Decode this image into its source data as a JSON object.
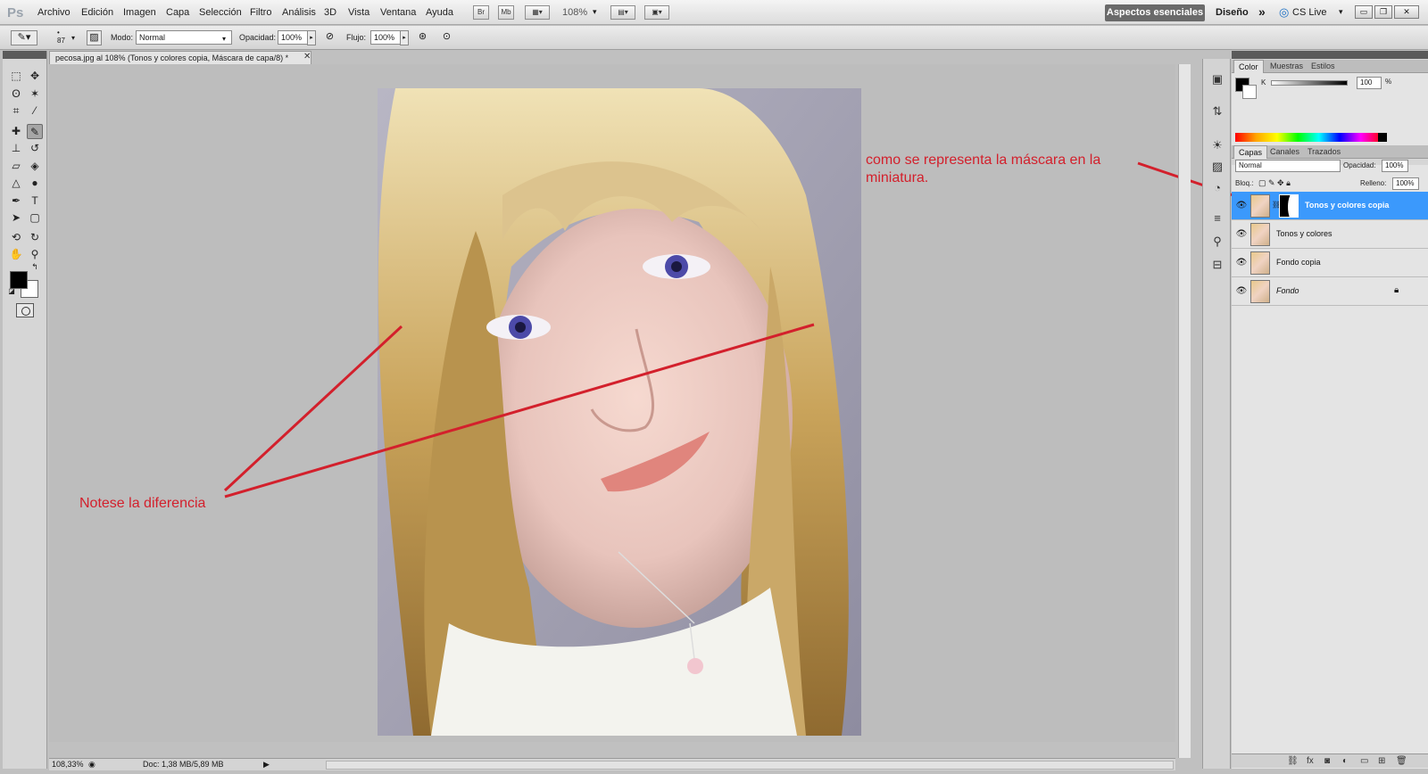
{
  "app": {
    "logo": "Ps",
    "menus": [
      "Archivo",
      "Edición",
      "Imagen",
      "Capa",
      "Selección",
      "Filtro",
      "Análisis",
      "3D",
      "Vista",
      "Ventana",
      "Ayuda"
    ],
    "bridge_btn": "Br",
    "minibridge_btn": "Mb",
    "zoom": "108%",
    "workspace": "Aspectos esenciales",
    "design": "Diseño",
    "more": "»",
    "cslive": "CS Live"
  },
  "options": {
    "brush_size": "87",
    "mode_label": "Modo:",
    "mode_value": "Normal",
    "opacity_label": "Opacidad:",
    "opacity_value": "100%",
    "flow_label": "Flujo:",
    "flow_value": "100%"
  },
  "document": {
    "tab_title": "pecosa.jpg al 108% (Tonos y colores copia, Máscara de capa/8) *"
  },
  "annotations": {
    "left_note": "Notese la diferencia",
    "right_note_line1": "como se representa la máscara en la",
    "right_note_line2": "miniatura."
  },
  "status": {
    "zoom": "108,33%",
    "doc": "Doc: 1,38 MB/5,89 MB"
  },
  "color_panel": {
    "tabs": [
      "Color",
      "Muestras",
      "Estilos"
    ],
    "channel": "K",
    "value": "100",
    "unit": "%"
  },
  "layers_panel": {
    "tabs": [
      "Capas",
      "Canales",
      "Trazados"
    ],
    "blend_mode": "Normal",
    "opacity_label": "Opacidad:",
    "opacity_value": "100%",
    "lock_label": "Bloq.:",
    "fill_label": "Relleno:",
    "fill_value": "100%",
    "layers": [
      {
        "name": "Tonos y colores copia",
        "selected": true,
        "has_mask": true
      },
      {
        "name": "Tonos y colores",
        "selected": false
      },
      {
        "name": "Fondo copia",
        "selected": false
      },
      {
        "name": "Fondo",
        "selected": false,
        "locked": true
      }
    ]
  },
  "colors": {
    "accent_selected": "#3b99fc",
    "annotation": "#d3202c"
  }
}
